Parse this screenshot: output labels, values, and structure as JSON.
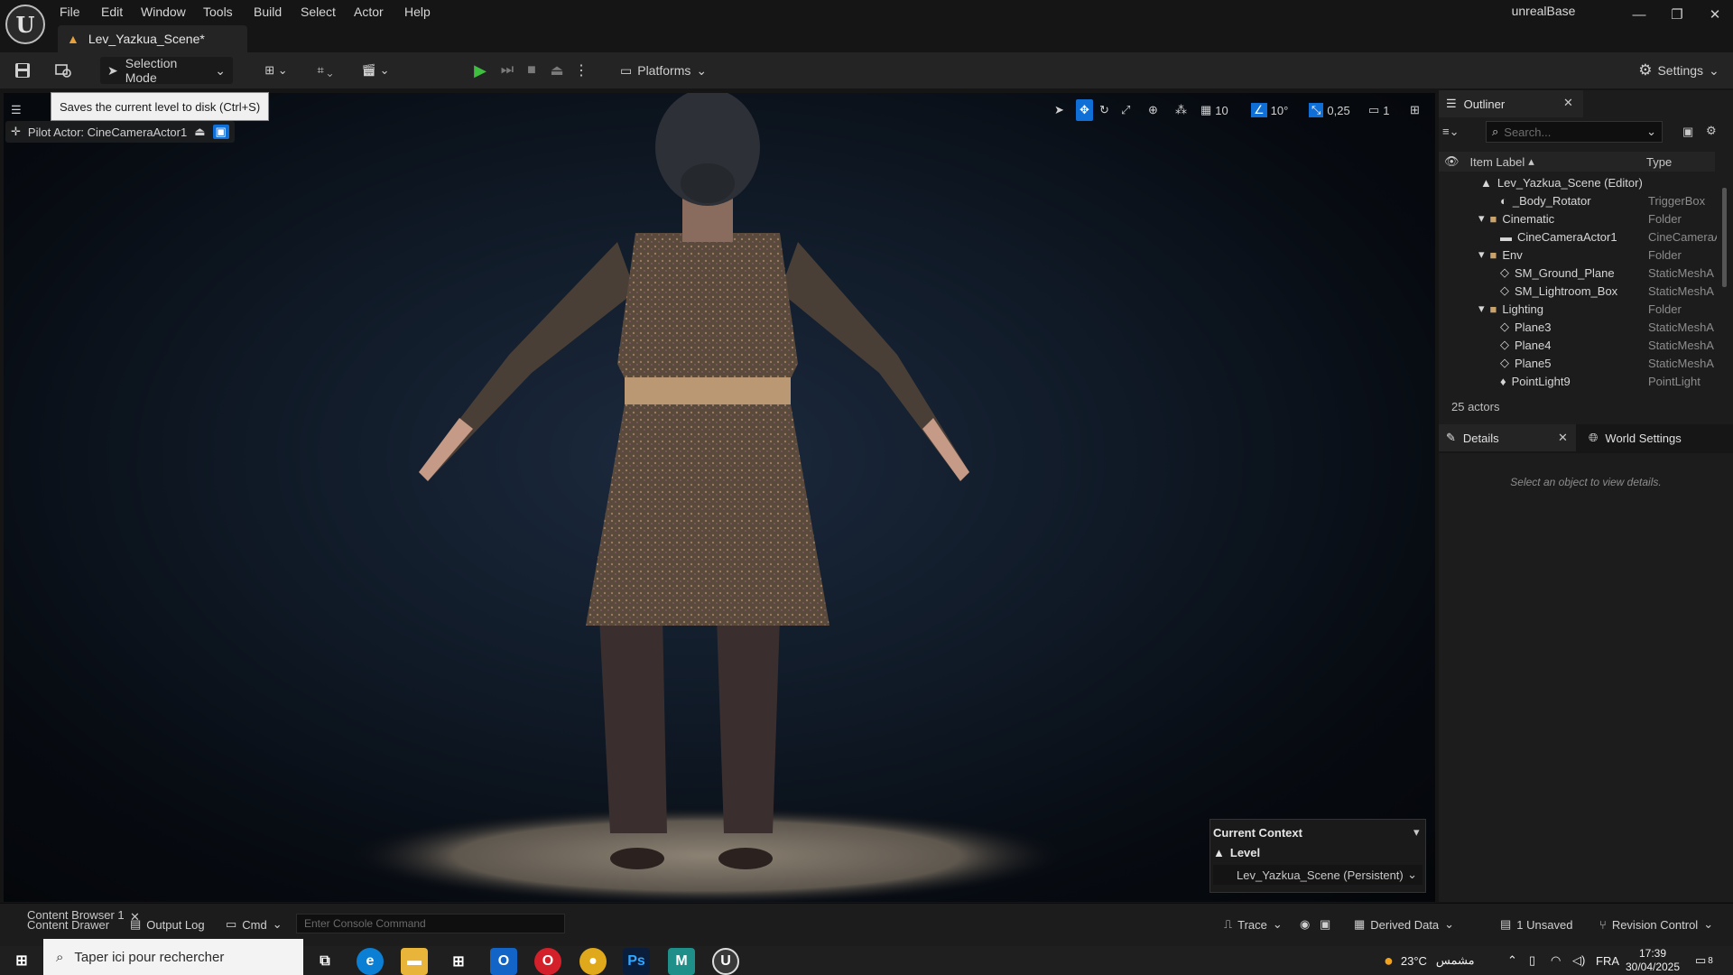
{
  "window": {
    "project_name": "unrealBase",
    "doc_tab": "Lev_Yazkua_Scene*",
    "menu": [
      "File",
      "Edit",
      "Window",
      "Tools",
      "Build",
      "Select",
      "Actor",
      "Help"
    ]
  },
  "toolbar": {
    "selection_mode": "Selection Mode",
    "platforms": "Platforms",
    "settings": "Settings"
  },
  "viewport": {
    "tooltip": "Saves the current level to disk (Ctrl+S)",
    "pilot_actor": "Pilot Actor: CineCameraActor1",
    "grid_snap": "10",
    "rotation_snap": "10°",
    "scale_snap": "0,25",
    "camera_speed": "1",
    "context": {
      "title": "Current Context",
      "level_label": "Level",
      "level_value": "Lev_Yazkua_Scene (Persistent)"
    }
  },
  "outliner": {
    "title": "Outliner",
    "search_placeholder": "Search...",
    "col_label": "Item Label",
    "col_type": "Type",
    "rows": [
      {
        "label": "Lev_Yazkua_Scene (Editor)",
        "type": ""
      },
      {
        "label": "_Body_Rotator",
        "type": "TriggerBox"
      },
      {
        "label": "Cinematic",
        "type": "Folder"
      },
      {
        "label": "CineCameraActor1",
        "type": "CineCameraA"
      },
      {
        "label": "Env",
        "type": "Folder"
      },
      {
        "label": "SM_Ground_Plane",
        "type": "StaticMeshA"
      },
      {
        "label": "SM_Lightroom_Box",
        "type": "StaticMeshA"
      },
      {
        "label": "Lighting",
        "type": "Folder"
      },
      {
        "label": "Plane3",
        "type": "StaticMeshA"
      },
      {
        "label": "Plane4",
        "type": "StaticMeshA"
      },
      {
        "label": "Plane5",
        "type": "StaticMeshA"
      },
      {
        "label": "PointLight9",
        "type": "PointLight"
      }
    ],
    "actor_count": "25 actors"
  },
  "details": {
    "title": "Details",
    "world_settings": "World Settings",
    "empty_msg": "Select an object to view details."
  },
  "bottom": {
    "content_browser": "Content Browser 1",
    "content_drawer": "Content Drawer",
    "output_log": "Output Log",
    "cmd": "Cmd",
    "console_placeholder": "Enter Console Command",
    "trace": "Trace",
    "derived_data": "Derived Data",
    "unsaved": "1 Unsaved",
    "revision_control": "Revision Control"
  },
  "taskbar": {
    "search": "Taper ici pour rechercher",
    "weather_temp": "23°C",
    "weather_text": "مشمس",
    "lang": "FRA",
    "time": "17:39",
    "date": "30/04/2025",
    "notif_count": "8"
  },
  "colors": {
    "accent": "#0f6fd6",
    "play": "#3fbf3f",
    "folder": "#c9a36b"
  }
}
